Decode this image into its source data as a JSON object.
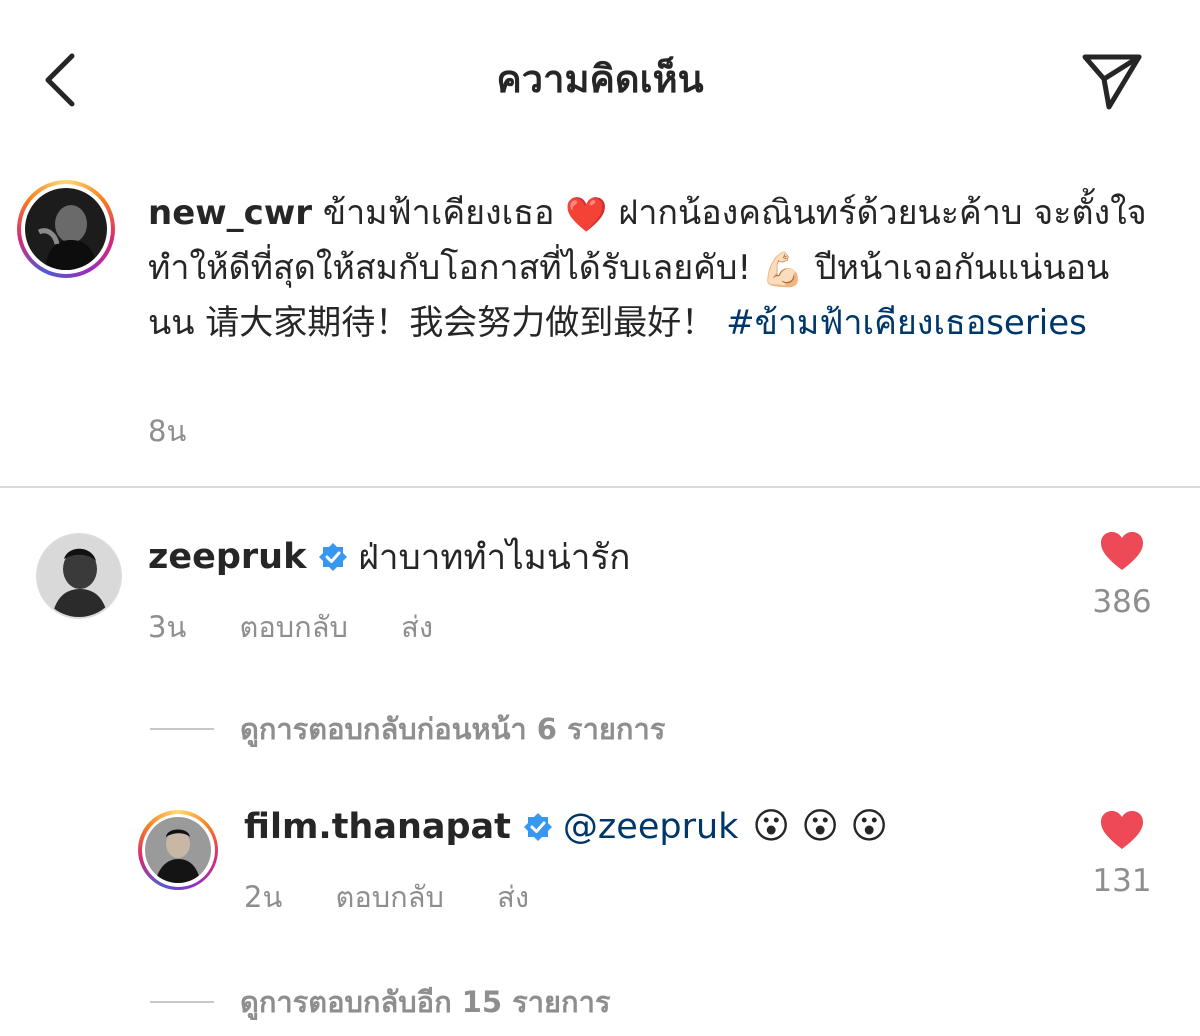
{
  "header": {
    "title": "ความคิดเห็น",
    "back_icon": "chevron-left-icon",
    "send_icon": "paper-plane-icon"
  },
  "post": {
    "username": "new_cwr",
    "caption_part1": "ข้ามฟ้าเคียงเธอ",
    "emoji_heart": "❤️",
    "caption_part2": "ฝากน้องคณินทร์ด้วยนะค้าบ จะตั้งใจทำให้ดีที่สุดให้สมกับโอกาสที่ได้รับเลยคับ!",
    "emoji_muscle": "💪🏻",
    "caption_part3": "ปีหน้าเจอกันแน่นอนนน 请大家期待！我会努力做到最好！",
    "hashtag": "#ข้ามฟ้าเคียงเธอseries",
    "time": "8น"
  },
  "comments": [
    {
      "username": "zeepruk",
      "verified": true,
      "text": "ฝ่าบาททำไมน่ารัก",
      "time": "3น",
      "reply_label": "ตอบกลับ",
      "send_label": "ส่ง",
      "likes": "386",
      "view_replies": "ดูการตอบกลับก่อนหน้า 6 รายการ"
    },
    {
      "username": "film.thanapat",
      "verified": true,
      "mention": "@zeepruk",
      "emojis": "😮 😮 😮",
      "time": "2น",
      "reply_label": "ตอบกลับ",
      "send_label": "ส่ง",
      "likes": "131",
      "view_replies": "ดูการตอบกลับอีก 15 รายการ"
    }
  ],
  "colors": {
    "text": "#262626",
    "secondary": "#8e8e8e",
    "link": "#00376b",
    "like_red": "#ed4956",
    "verified_blue": "#3897f0",
    "divider": "#dbdbdb"
  }
}
